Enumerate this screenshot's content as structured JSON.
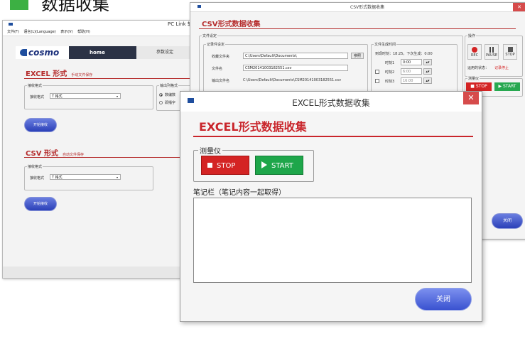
{
  "heading": "数据收集",
  "pclink": {
    "title": "PC Link 软",
    "menu": [
      "文件(F)",
      "语言(L)(Language)",
      "表示(V)",
      "帮助(H)"
    ],
    "logo": "COSMO",
    "nav_home": "home",
    "nav_param": "参数设定",
    "excel_title": "EXCEL 形式",
    "excel_sub": "手动文件保存",
    "recv_group": "接收格式",
    "recv_label": "接收格式",
    "recv_value": "T 格式",
    "output_group": "输出列格式",
    "radio1": "数编数",
    "radio2": "即播字",
    "start_recv": "开始接收",
    "csv_title": "CSV 形式",
    "csv_sub": "自动文件保存",
    "recv_group2": "接收格式",
    "recv_label2": "接收格式",
    "recv_value2": "T 格式",
    "start_recv2": "开始接收"
  },
  "csv": {
    "title": "CSV形式数据收集",
    "heading": "CSV形式数据收集",
    "file_group": "文件设定",
    "record_group": "记录件设定",
    "folder_label": "收藏文件夹",
    "folder_value": "C:\\Users\\Default\\Documents\\",
    "browse": "参照",
    "filename_label": "文件名",
    "filename_value": "CSM20141003182551.csv",
    "output_label": "输出文件名",
    "output_value": "C:\\Users\\Default\\Documents\\CSM20141003182551.csv",
    "time_group": "文件生成时间",
    "time_info": "到现时刻：18:25，下次生成：0:00",
    "time1_label": "时刻1",
    "time1_value": "0:00",
    "time2_label": "时刻2",
    "time2_value": "6:00",
    "time3_label": "时刻3",
    "time3_value": "16:00",
    "ops_group": "操作",
    "rec": "REC",
    "pause": "PAUSE",
    "stop": "STOP",
    "running_label": "运用的状态：",
    "running_value": "记录停止",
    "meter_group": "测量仪",
    "meter_stop": "STOP",
    "meter_start": "START",
    "close": "关闭"
  },
  "excel": {
    "title": "EXCEL形式数据收集",
    "heading": "EXCEL形式数据收集",
    "meter_group": "测量仪",
    "stop": "STOP",
    "start": "START",
    "notes_label": "笔记栏（笔记内容一起取得）",
    "notes_value": "",
    "close": "关闭"
  }
}
